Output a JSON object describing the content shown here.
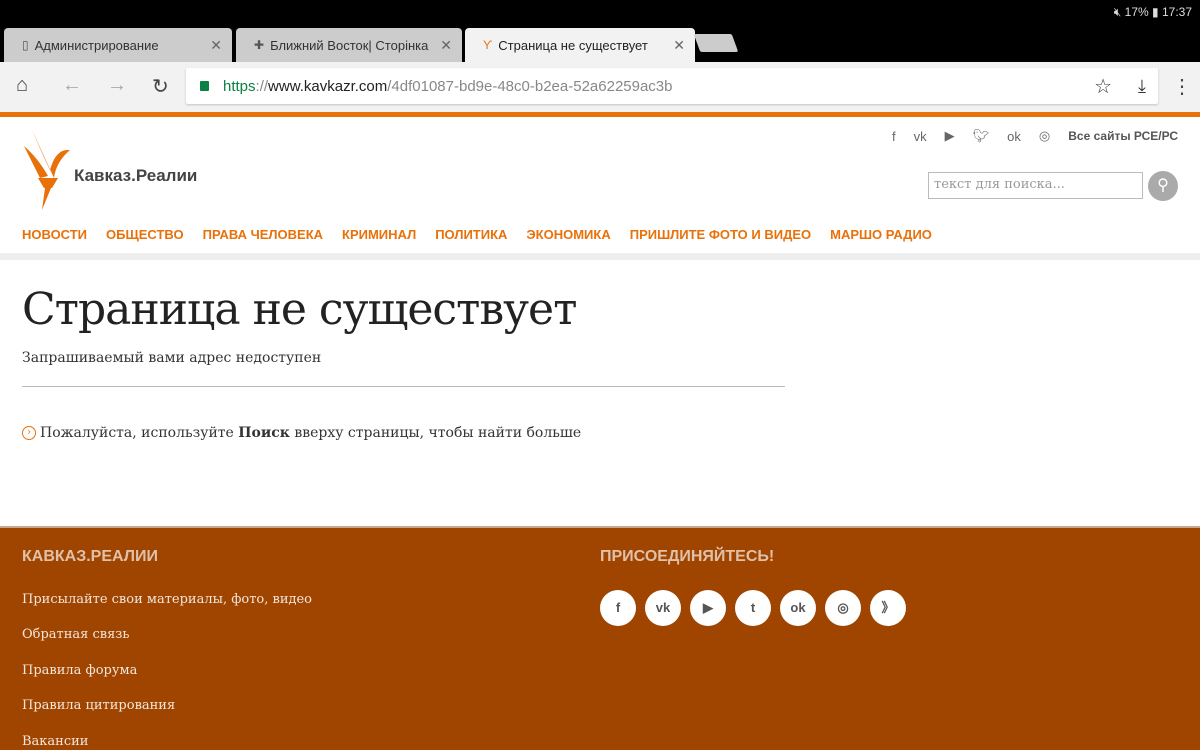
{
  "status_bar": {
    "battery": "17%",
    "time": "17:37"
  },
  "tabs": [
    {
      "label": "Администрирование",
      "icon": "page-icon"
    },
    {
      "label": "Ближний Восток| Сторінка",
      "icon": "cross-icon"
    },
    {
      "label": "Страница не существует",
      "icon": "rferl-icon"
    }
  ],
  "address": {
    "scheme": "https",
    "sep": "://",
    "host": "www.kavkazr.com",
    "path": "/4df01087-bd9e-48c0-b2ea-52a62259ac3b"
  },
  "site": {
    "logo": "Кавказ.Реалии",
    "all_sites": "Все сайты РСЕ/РС",
    "search_placeholder": "текст для поиска...",
    "nav": [
      "НОВОСТИ",
      "ОБЩЕСТВО",
      "ПРАВА ЧЕЛОВЕКА",
      "КРИМИНАЛ",
      "ПОЛИТИКА",
      "ЭКОНОМИКА",
      "ПРИШЛИТЕ ФОТО И ВИДЕО",
      "МАРШО РАДИО"
    ]
  },
  "main": {
    "title": "Страница не существует",
    "subtitle": "Запрашиваемый вами адрес недоступен",
    "hint_before": "Пожалуйста, используйте ",
    "hint_bold": "Поиск",
    "hint_after": " вверху страницы, чтобы найти больше"
  },
  "footer": {
    "col1_title": "КАВКАЗ.РЕАЛИИ",
    "links": [
      "Присылайте свои материалы, фото, видео",
      "Обратная связь",
      "Правила форума",
      "Правила цитирования",
      "Вакансии"
    ],
    "col2_title": "ПРИСОЕДИНЯЙТЕСЬ!"
  },
  "colors": {
    "accent": "#e8710a",
    "footer": "#a04500"
  }
}
